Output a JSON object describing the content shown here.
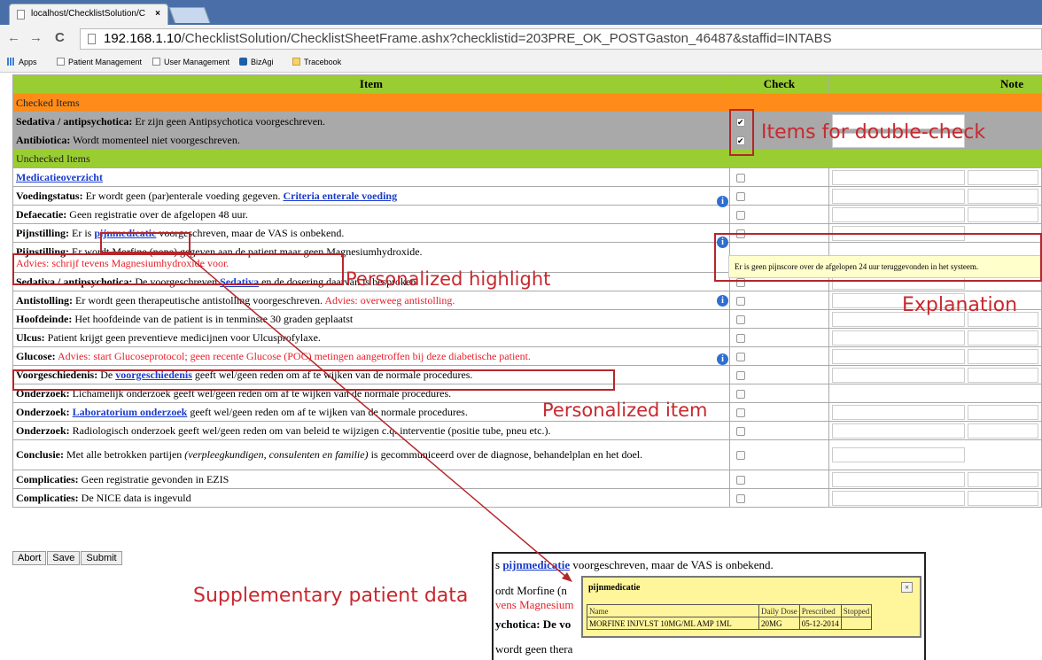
{
  "browser": {
    "tab_title": "localhost/ChecklistSolution/C",
    "tab_close": "×",
    "url_host": "192.168.1.10",
    "url_path": "/ChecklistSolution/ChecklistSheetFrame.ashx?checklistid=203PRE_OK_POSTGaston_46487&staffid=INTABS",
    "back": "←",
    "forward": "→",
    "reload": "C",
    "bookmarks": [
      "Apps",
      "Patient Management",
      "User Management",
      "BizAgi",
      "Tracebook"
    ]
  },
  "table": {
    "headers": {
      "item": "Item",
      "check": "Check",
      "note": "Note"
    },
    "section_checked": "Checked Items",
    "section_unchecked": "Unchecked Items",
    "checked_rows": [
      {
        "bold": "Sedativa / antipsychotica:",
        "text": " Er zijn geen Antipsychotica voorgeschreven."
      },
      {
        "bold": "Antibiotica:",
        "text": " Wordt momenteel niet voorgeschreven."
      }
    ],
    "check_mark": "✔",
    "info_glyph": "i",
    "rows": {
      "medicatie": "Medicatieoverzicht",
      "voeding_b": "Voedingstatus:",
      "voeding_t": " Er wordt geen (par)enterale voeding gegeven. ",
      "voeding_l": "Criteria enterale voeding",
      "defaecatie_b": "Defaecatie:",
      "defaecatie_t": " Geen registratie over de afgelopen 48 uur.",
      "pijn1_b": "Pijnstilling:",
      "pijn1_t1": " Er is ",
      "pijn1_l": "pijnmedicatie",
      "pijn1_t2": " voorgeschreven, maar de VAS is onbekend.",
      "pijn2_b": "Pijnstilling:",
      "pijn2_t": " Er wordt Morfine (none) gegeven aan de patient maar geen Magnesiumhydroxide.",
      "pijn2_r": "Advies: schrijf tevens Magnesiumhydroxide voor.",
      "sed_b": "Sedativa / antipsychotica:",
      "sed_t1": " De voorgeschreven ",
      "sed_l": "Sedativa",
      "sed_t2": " en de dosering daarvan is besproken.",
      "anti_b": "Antistolling:",
      "anti_t": " Er wordt geen therapeutische antistolling voorgeschreven. ",
      "anti_r": "Advies: overweeg antistolling.",
      "hoofd_b": "Hoofdeinde:",
      "hoofd_t": " Het hoofdeinde van de patient is in tenminste 30 graden geplaatst",
      "ulcus_b": "Ulcus:",
      "ulcus_t": " Patient krijgt geen preventieve medicijnen voor Ulcusprofylaxe.",
      "glucose_b": "Glucose:",
      "glucose_r": " Advies: start Glucoseprotocol; geen recente Glucose (POC) metingen aangetroffen bij deze diabetische patient.",
      "voorg_b": "Voorgeschiedenis:",
      "voorg_t1": " De ",
      "voorg_l": "voorgeschiedenis",
      "voorg_t2": " geeft wel/geen reden om af te wijken van de normale procedures.",
      "ond1_b": "Onderzoek:",
      "ond1_t": " Lichamelijk onderzoek geeft wel/geen reden om af te wijken van de normale procedures.",
      "ond2_b": "Onderzoek:",
      "ond2_l": "Laboratorium onderzoek",
      "ond2_t": " geeft wel/geen reden om af te wijken van de normale procedures.",
      "ond3_b": "Onderzoek:",
      "ond3_t": " Radiologisch onderzoek geeft wel/geen reden om van beleid te wijzigen c.q. interventie (positie tube, pneu etc.).",
      "concl_b": "Conclusie:",
      "concl_t1": " Met alle betrokken partijen ",
      "concl_i": "(verpleegkundigen, consulenten en familie)",
      "concl_t2": " is gecommuniceerd over de diagnose, behandelplan en het doel.",
      "compl1_b": "Complicaties:",
      "compl1_t": " Geen registratie gevonden in EZIS",
      "compl2_b": "Complicaties:",
      "compl2_t": " De NICE data is ingevuld"
    },
    "tooltip": "Er is geen pijnscore over de afgelopen 24 uur teruggevonden in het systeem."
  },
  "buttons": {
    "abort": "Abort",
    "save": "Save",
    "submit": "Submit"
  },
  "annotations": {
    "double_check": "Items for double-check",
    "personalized_highlight": "Personalized highlight",
    "explanation": "Explanation",
    "personalized_item": "Personalized item",
    "supplementary": "Supplementary  patient data"
  },
  "inset": {
    "line1_pre": "s ",
    "line1_link": "pijnmedicatie",
    "line1_post": " voorgeschreven, maar de VAS is onbekend.",
    "line2": "ordt Morfine (n",
    "line3": "vens Magnesium",
    "line4": "ychotica: De vo",
    "line5": "wordt geen thera",
    "popup_title": "pijnmedicatie",
    "popup_close": "×",
    "popup_headers": [
      "Name",
      "Daily Dose",
      "Prescribed",
      "Stopped"
    ],
    "popup_row": [
      "MORFINE INJVLST 10MG/ML AMP 1ML",
      "20MG",
      "05-12-2014",
      ""
    ]
  },
  "colors": {
    "annotation": "#c8282e",
    "header_green": "#9acd32",
    "section_orange": "#ff8c1a",
    "link": "#1a3bcc",
    "advice_red": "#e8202a"
  }
}
